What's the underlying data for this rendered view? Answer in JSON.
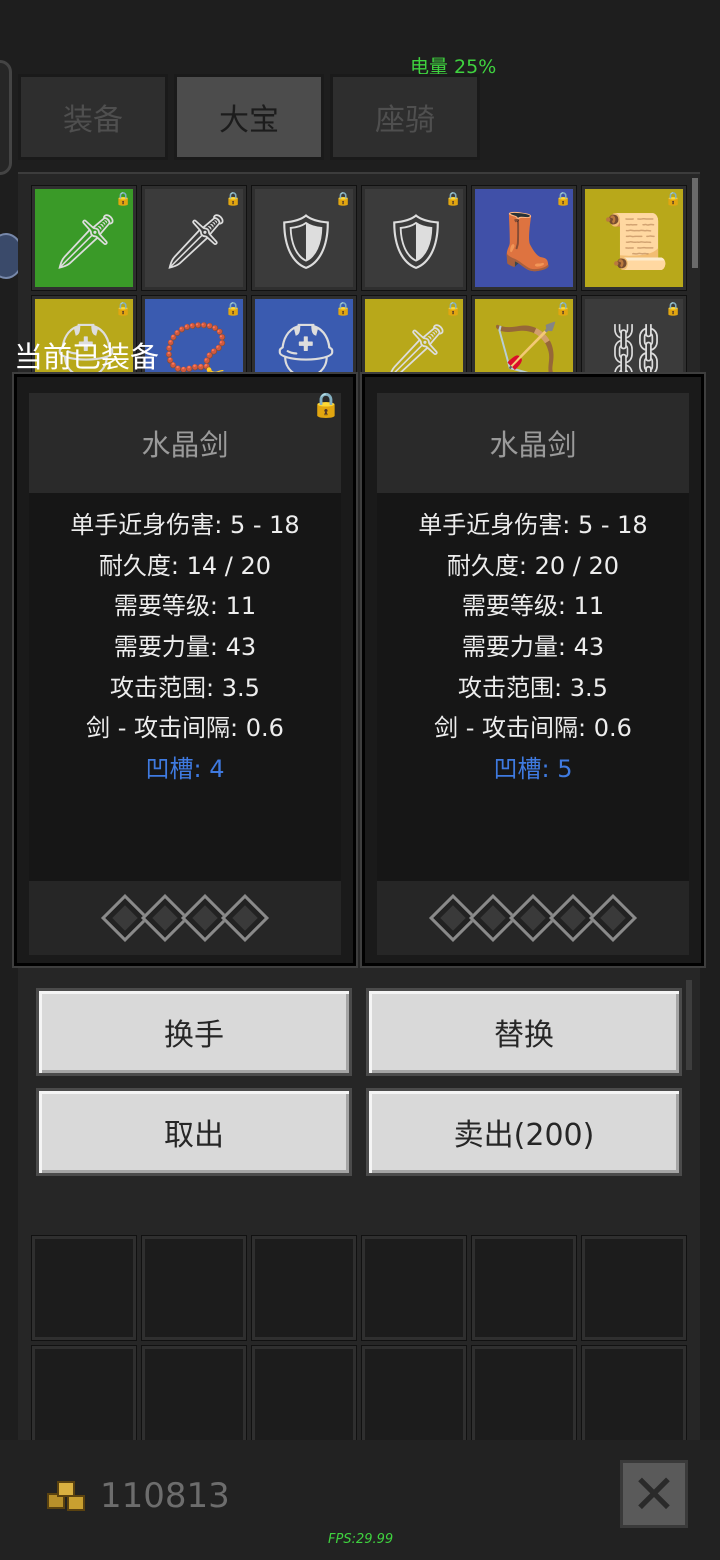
{
  "status": {
    "battery": "电量 25%",
    "fps": "FPS:29.99"
  },
  "tabs": [
    {
      "label": "装备",
      "active": false
    },
    {
      "label": "大宝",
      "active": true
    },
    {
      "label": "座骑",
      "active": false
    }
  ],
  "inventory_preview": [
    {
      "icon": "sword-icon",
      "glyph": "🗡",
      "bg": "#3a9a28"
    },
    {
      "icon": "sword-icon",
      "glyph": "🗡",
      "bg": "#3b3b3b"
    },
    {
      "icon": "shield-icon",
      "glyph": "🛡",
      "bg": "#3b3b3b"
    },
    {
      "icon": "shield-icon",
      "glyph": "🛡",
      "bg": "#3b3b3b"
    },
    {
      "icon": "boots-icon",
      "glyph": "👢",
      "bg": "#4050a8"
    },
    {
      "icon": "scroll-icon",
      "glyph": "📜",
      "bg": "#b8a81a"
    },
    {
      "icon": "helmet-icon",
      "glyph": "⛑",
      "bg": "#b8a81a"
    },
    {
      "icon": "amulet-icon",
      "glyph": "📿",
      "bg": "#3a5bb0"
    },
    {
      "icon": "helmet-icon",
      "glyph": "⛑",
      "bg": "#3a5bb0"
    },
    {
      "icon": "sword-icon",
      "glyph": "🗡",
      "bg": "#b8a81a"
    },
    {
      "icon": "crossbow-icon",
      "glyph": "🏹",
      "bg": "#b8a81a"
    },
    {
      "icon": "chain-icon",
      "glyph": "⛓",
      "bg": "#3b3b3b"
    }
  ],
  "equipped_label": "当前已装备",
  "cards": [
    {
      "title": "水晶剑",
      "locked": true,
      "stats": [
        "单手近身伤害: 5 - 18",
        "耐久度: 14 / 20",
        "需要等级: 11",
        "需要力量: 43",
        "攻击范围: 3.5",
        "剑 - 攻击间隔: 0.6"
      ],
      "sockets_label": "凹槽: 4",
      "socket_count": 4
    },
    {
      "title": "水晶剑",
      "locked": false,
      "stats": [
        "单手近身伤害: 5 - 18",
        "耐久度: 20 / 20",
        "需要等级: 11",
        "需要力量: 43",
        "攻击范围: 3.5",
        "剑 - 攻击间隔: 0.6"
      ],
      "sockets_label": "凹槽: 5",
      "socket_count": 5
    }
  ],
  "actions": {
    "swap_hand": "换手",
    "replace": "替换",
    "take_out": "取出",
    "sell": "卖出(200)"
  },
  "gold": {
    "value": "110813",
    "icon": "gold-coins-icon"
  },
  "close": {
    "icon": "close-icon",
    "glyph": "✕"
  }
}
